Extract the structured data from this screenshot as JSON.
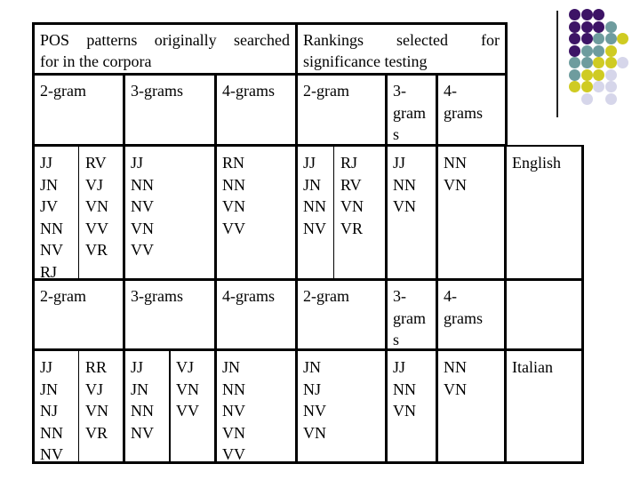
{
  "header": {
    "original_title": "POS patterns originally searched for in the corpora",
    "original_title_line1": "POS patterns originally searched",
    "original_title_line2": "for in the corpora",
    "rankings_title_line1": "Rankings selected for",
    "rankings_title_line1_words": [
      "Rankings",
      "selected",
      "for"
    ],
    "rankings_title_line2": "significance testing"
  },
  "column_labels": {
    "orig_2gram": "2-gram",
    "orig_3grams": "3-grams",
    "orig_4grams": "4-grams",
    "rank_2gram": "2-gram",
    "rank_3grams_lines": [
      "3-",
      "gram",
      "s"
    ],
    "rank_4grams_lines": [
      "4-",
      "grams"
    ]
  },
  "sections": [
    {
      "language": "English",
      "orig_2gram_col1": [
        "JJ",
        "JN",
        "JV",
        "NN",
        "NV",
        "RJ"
      ],
      "orig_2gram_col2": [
        "RV",
        "VJ",
        "VN",
        "VV",
        "VR"
      ],
      "orig_3grams_col1": [
        "JJ",
        "NN",
        "NV",
        "VN",
        "VV"
      ],
      "orig_3grams_col2": [],
      "orig_4grams": [
        "RN",
        "NN",
        "VN",
        "VV"
      ],
      "rank_2gram_col1": [
        "JJ",
        "JN",
        "NN",
        "NV"
      ],
      "rank_2gram_col2": [
        "RJ",
        "RV",
        "VN",
        "VR"
      ],
      "rank_3grams": [
        "JJ",
        "NN",
        "VN"
      ],
      "rank_4grams": [
        "NN",
        "VN"
      ]
    },
    {
      "language": "Italian",
      "orig_2gram_col1": [
        "JJ",
        "JN",
        "NJ",
        "NN",
        "NV"
      ],
      "orig_2gram_col2": [
        "RR",
        "VJ",
        "VN",
        "VR"
      ],
      "orig_3grams_col1": [
        "JJ",
        "JN",
        "NN",
        "NV"
      ],
      "orig_3grams_col2": [
        "VJ",
        "VN",
        "VV"
      ],
      "orig_4grams": [
        "JN",
        "NN",
        "NV",
        "VN",
        "VV"
      ],
      "rank_2gram_col1": [
        "JN",
        "NJ",
        "NV",
        "VN"
      ],
      "rank_2gram_col2": [],
      "rank_3grams": [
        "JJ",
        "NN",
        "VN"
      ],
      "rank_4grams": [
        "NN",
        "VN"
      ]
    }
  ],
  "decoration": {
    "dot_colors": {
      "purple": "#3d1466",
      "teal": "#6e9c9e",
      "yellow": "#cfcb22",
      "lavender": "#d6d6ea"
    },
    "dot_grid": [
      [
        "purple",
        "purple",
        "purple",
        null,
        null
      ],
      [
        "purple",
        "purple",
        "purple",
        "teal",
        null
      ],
      [
        "purple",
        "purple",
        "teal",
        "teal",
        "yellow"
      ],
      [
        "purple",
        "teal",
        "teal",
        "yellow",
        null
      ],
      [
        "teal",
        "teal",
        "yellow",
        "yellow",
        "lavender"
      ],
      [
        "teal",
        "yellow",
        "yellow",
        "lavender",
        null
      ],
      [
        "yellow",
        "yellow",
        "lavender",
        "lavender",
        null
      ],
      [
        null,
        "lavender",
        null,
        "lavender",
        null
      ]
    ]
  }
}
